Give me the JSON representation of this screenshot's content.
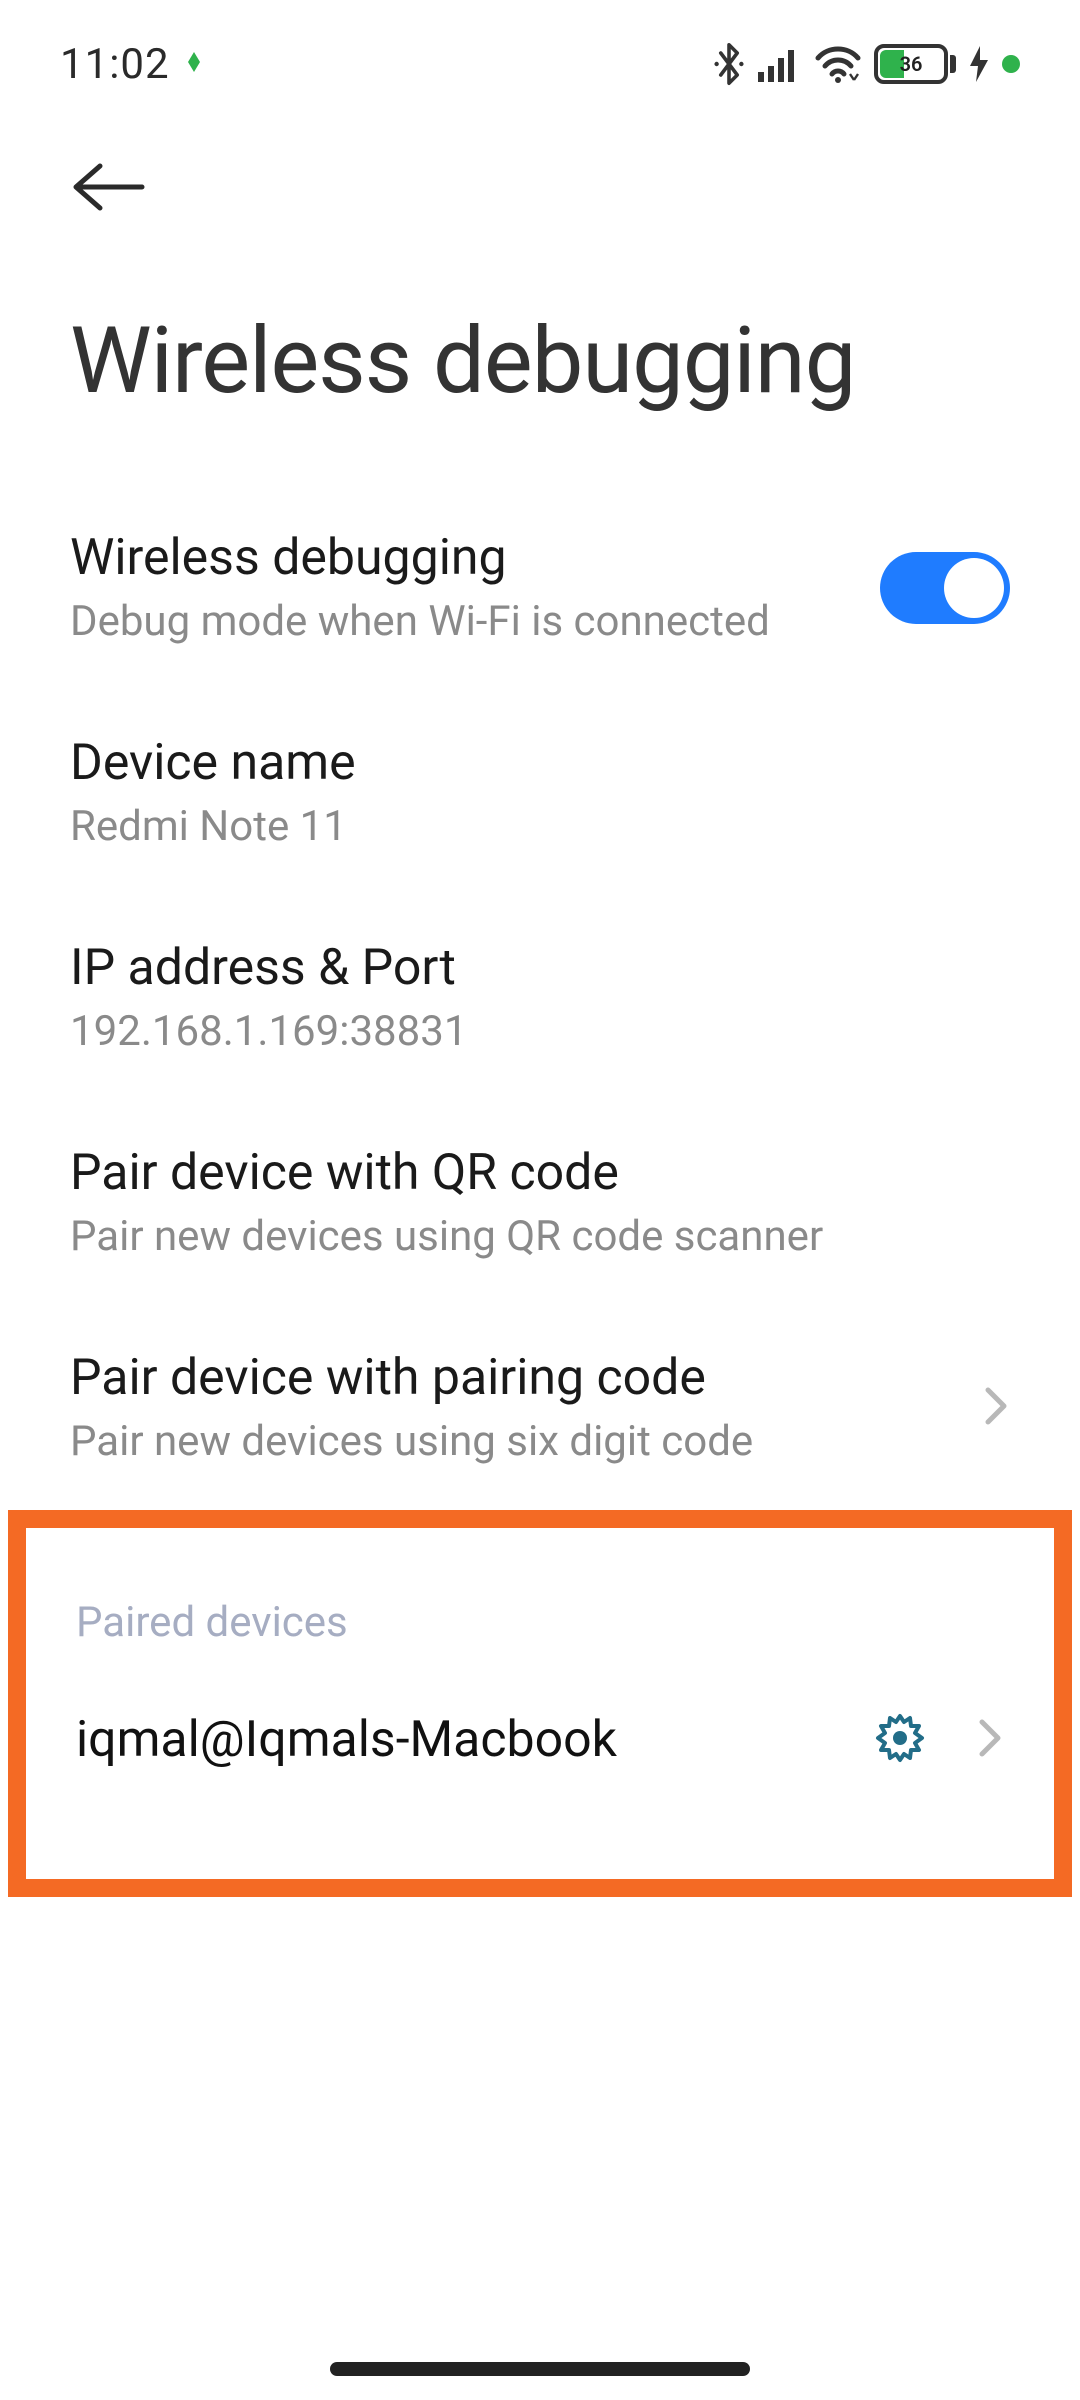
{
  "status": {
    "time": "11:02",
    "battery_pct": "36"
  },
  "page": {
    "title": "Wireless debugging"
  },
  "rows": {
    "wireless_debugging": {
      "title": "Wireless debugging",
      "subtitle": "Debug mode when Wi-Fi is connected",
      "enabled": true
    },
    "device_name": {
      "title": "Device name",
      "value": "Redmi Note 11"
    },
    "ip_port": {
      "title": "IP address & Port",
      "value": "192.168.1.169:38831"
    },
    "pair_qr": {
      "title": "Pair device with QR code",
      "subtitle": "Pair new devices using QR code scanner"
    },
    "pair_code": {
      "title": "Pair device with pairing code",
      "subtitle": "Pair new devices using six digit code"
    }
  },
  "paired_section": {
    "label": "Paired devices",
    "devices": [
      {
        "name": "iqmal@Iqmals-Macbook"
      }
    ]
  },
  "colors": {
    "accent": "#1f7cff",
    "highlight_border": "#f46a24",
    "gear": "#226d88"
  }
}
